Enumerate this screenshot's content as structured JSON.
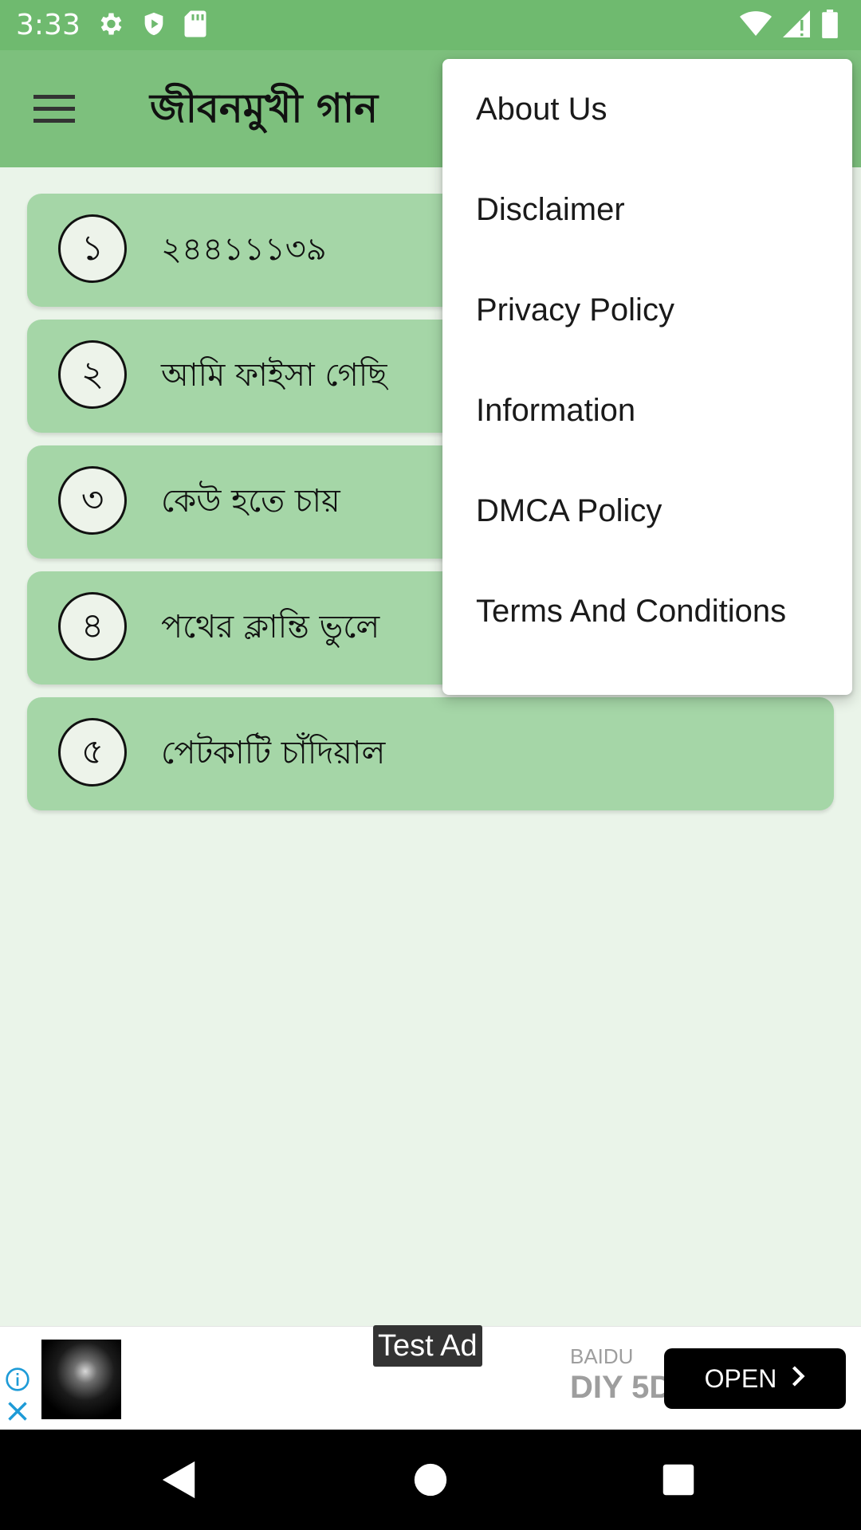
{
  "status_bar": {
    "time": "3:33",
    "icons_left": [
      "gear-icon",
      "shield-icon",
      "sd-card-icon"
    ],
    "icons_right": [
      "wifi-icon",
      "signal-icon",
      "battery-icon"
    ]
  },
  "app_bar": {
    "title": "জীবনমুখী গান",
    "menu_icon": "hamburger-menu-icon"
  },
  "songs": [
    {
      "number": "১",
      "title": "২৪৪১১১৩৯"
    },
    {
      "number": "২",
      "title": "আমি ফাইসা গেছি"
    },
    {
      "number": "৩",
      "title": "কেউ হতে চায়"
    },
    {
      "number": "৪",
      "title": "পথের ক্লান্তি ভুলে"
    },
    {
      "number": "৫",
      "title": "পেটকাটি চাঁদিয়াল"
    }
  ],
  "overflow_menu": {
    "items": [
      {
        "label": "About Us"
      },
      {
        "label": "Disclaimer"
      },
      {
        "label": "Privacy Policy"
      },
      {
        "label": "Information"
      },
      {
        "label": "DMCA Policy"
      },
      {
        "label": "Terms And Conditions"
      }
    ]
  },
  "ad": {
    "label": "Test Ad",
    "advertiser": "BAIDU",
    "headline": "DIY 5D",
    "cta": "OPEN"
  },
  "nav_bar": {
    "buttons": [
      "back-icon",
      "home-icon",
      "recents-icon"
    ]
  },
  "colors": {
    "status_bar": "#6fba6f",
    "app_bar": "#7dc07d",
    "card": "#a5d6a7",
    "background": "#eaf4e9"
  }
}
